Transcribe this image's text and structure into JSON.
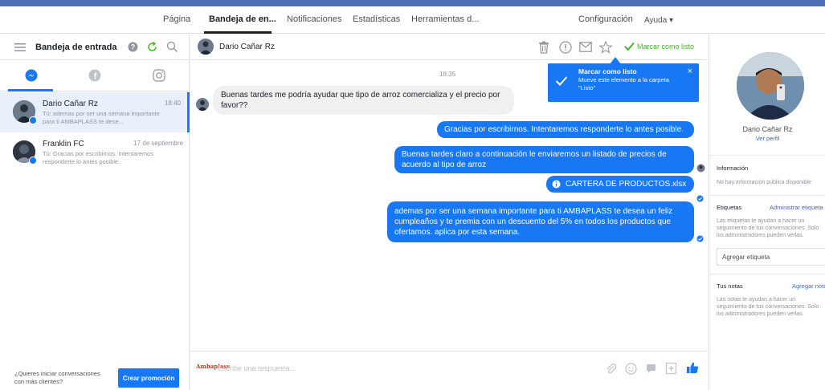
{
  "colors": {
    "accent": "#1877f2",
    "ready_green": "#42b72a",
    "link": "#4267b2",
    "bubble_in": "#f1f0f0"
  },
  "topnav": {
    "tabs": [
      {
        "label": "Página"
      },
      {
        "label": "Bandeja de en..."
      },
      {
        "label": "Notificaciones"
      },
      {
        "label": "Estadísticas"
      },
      {
        "label": "Herramientas d..."
      },
      {
        "label": "Configuración"
      },
      {
        "label": "Ayuda ▾"
      }
    ]
  },
  "inbox": {
    "title": "Bandeja de entrada",
    "icons": [
      "menu-icon",
      "help-icon",
      "refresh-icon",
      "search-icon"
    ],
    "filters": [
      "messenger-icon",
      "facebook-icon",
      "instagram-icon"
    ],
    "conversations": [
      {
        "name": "Dario Cañar Rz",
        "time": "18:40",
        "snippet": "Tú: ademas por ser una semana importante para ti AMBAPLASS te dese..."
      },
      {
        "name": "Franklin FC",
        "time": "17 de septiembre",
        "snippet": "Tú: Gracias por escribirnos. Intentaremos responderte lo antes posible."
      }
    ],
    "footer_question": "¿Quieres iniciar conversaciones con más clientes?",
    "promo_button": "Crear promoción"
  },
  "chat": {
    "contact_name": "Dario Cañar Rz",
    "header_icons": [
      "trash-icon",
      "info-icon",
      "mail-icon",
      "star-icon"
    ],
    "mark_ready": "Marcar como listo",
    "timestamp": "18:35",
    "tooltip": {
      "title": "Marcar como listo",
      "body": "Mueve este elemento a la carpeta \"Listo\"",
      "close": "×"
    },
    "messages": [
      {
        "from": "contact",
        "text": "Buenas tardes me podría ayudar que tipo de arroz comercializa y el precio por favor??"
      },
      {
        "from": "page",
        "text": "Gracias por escribirnos. Intentaremos responderte lo antes posible."
      },
      {
        "from": "page",
        "text": "Buenas tardes claro a continuación le enviaremos un listado de precios de acuerdo al tipo de arroz"
      },
      {
        "from": "page",
        "text": "CARTERA DE PRODUCTOS.xlsx"
      },
      {
        "from": "page",
        "text": "ademas por ser una semana importante para ti AMBAPLASS te desea un feliz cumpleaños y te premia con un descuento del 5% en todos los productos que ofertamos. aplica por esta semana."
      }
    ],
    "composer": {
      "page_tag": "Ambaplass",
      "placeholder": "Escribe una respuesta...",
      "icons": [
        "attach-icon",
        "emoji-icon",
        "chat-icon",
        "save-reply-icon",
        "like-icon"
      ]
    }
  },
  "profile": {
    "name": "Dario Cañar Rz",
    "view_profile": "Ver perfil",
    "info_title": "Información",
    "info_text": "No hay información pública disponible",
    "tags_title": "Etiquetas",
    "tags_link": "Administrar etiqueta",
    "tags_text": "Las etiquetas te ayudan a hacer un seguimiento de tus conversaciones. Solo los administradores pueden verlas.",
    "tags_placeholder": "Agregar etiqueta",
    "notes_title": "Tus notas",
    "notes_link": "Agregar nota",
    "notes_text": "Las notas te ayudan a hacer un seguimiento de tus conversaciones. Solo los administradores pueden verlas."
  }
}
